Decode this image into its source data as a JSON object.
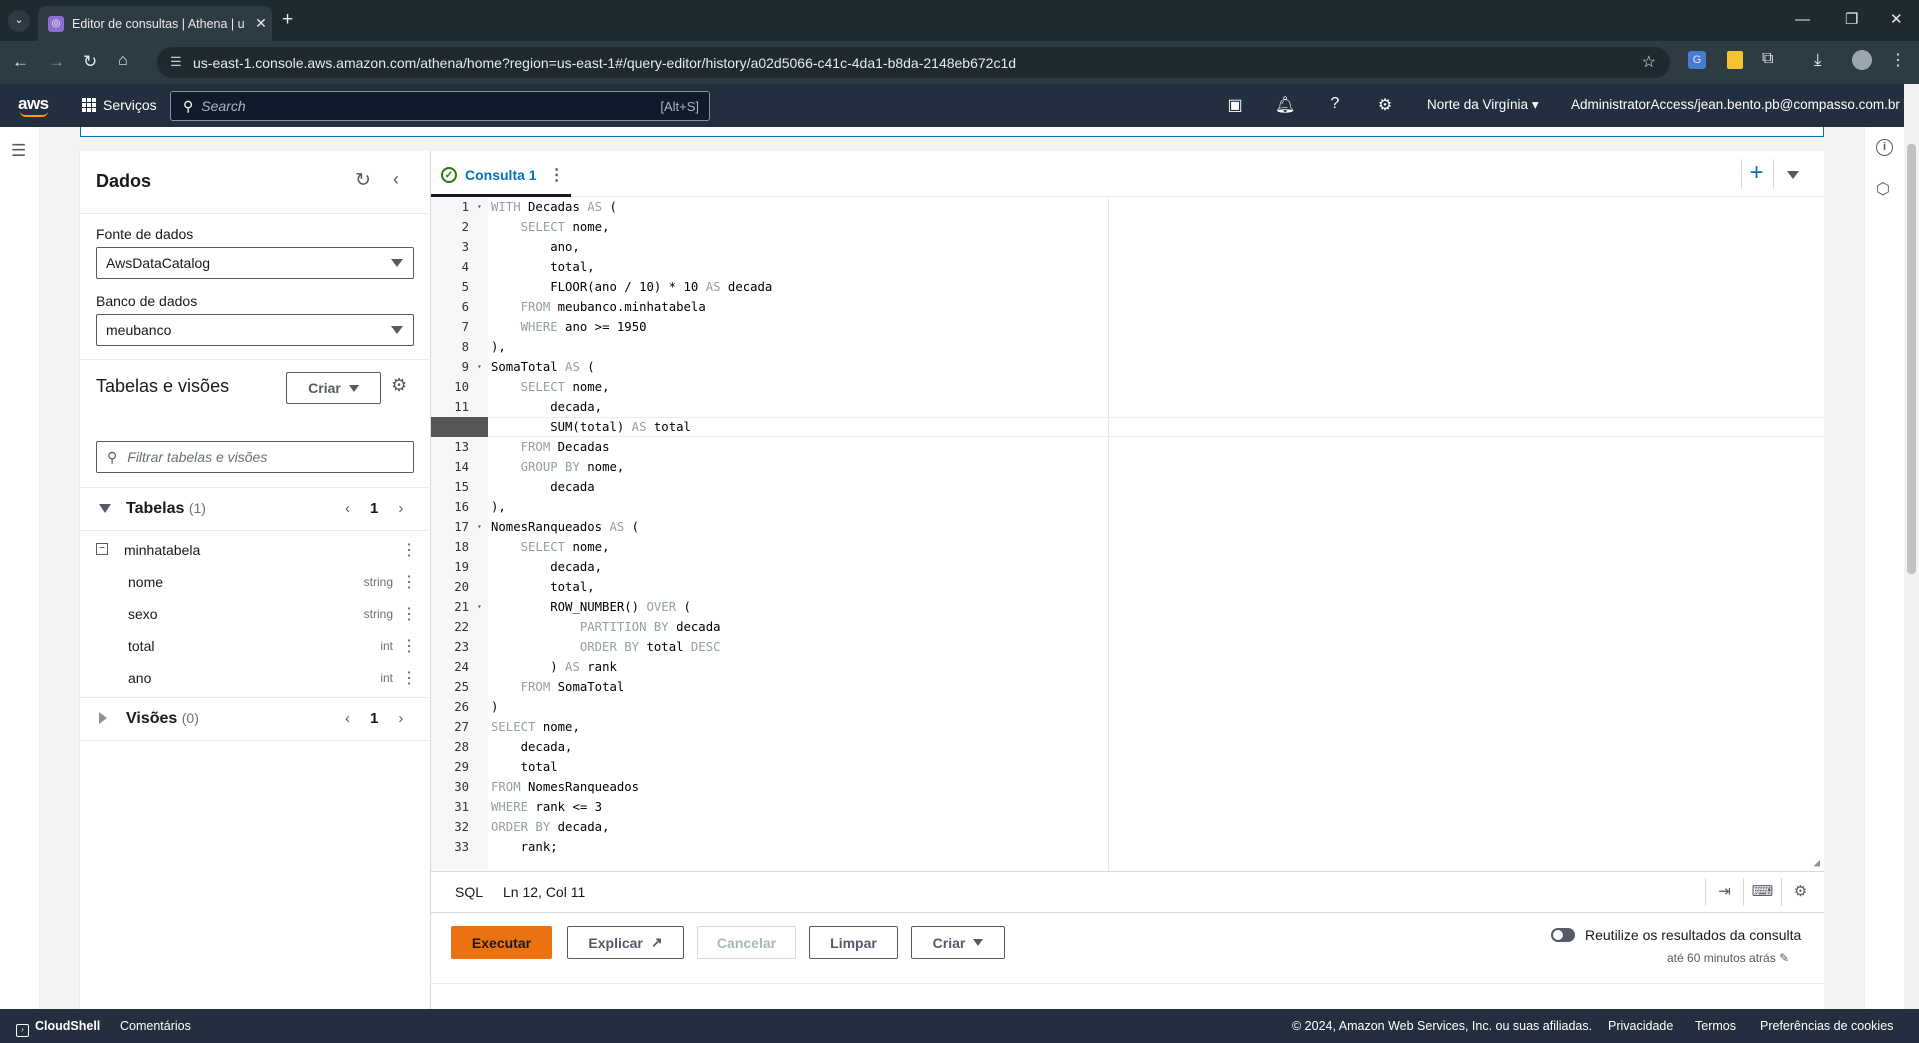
{
  "browser": {
    "tab_title": "Editor de consultas | Athena | u",
    "url": "us-east-1.console.aws.amazon.com/athena/home?region=us-east-1#/query-editor/history/a02d5066-c41c-4da1-b8da-2148eb672c1d"
  },
  "aws_nav": {
    "logo": "aws",
    "services_label": "Serviços",
    "search_placeholder": "Search",
    "search_shortcut": "[Alt+S]",
    "region": "Norte da Virgínia",
    "account": "AdministratorAccess/jean.bento.pb@compasso.com.br"
  },
  "data_panel": {
    "title": "Dados",
    "source_label": "Fonte de dados",
    "source_value": "AwsDataCatalog",
    "db_label": "Banco de dados",
    "db_value": "meubanco",
    "tables_views_title": "Tabelas e visões",
    "create_label": "Criar",
    "filter_placeholder": "Filtrar tabelas e visões",
    "tables": {
      "label": "Tabelas",
      "count": "(1)",
      "page": "1"
    },
    "table_name": "minhatabela",
    "columns": [
      {
        "name": "nome",
        "type": "string"
      },
      {
        "name": "sexo",
        "type": "string"
      },
      {
        "name": "total",
        "type": "int"
      },
      {
        "name": "ano",
        "type": "int"
      }
    ],
    "views": {
      "label": "Visões",
      "count": "(0)",
      "page": "1"
    }
  },
  "editor": {
    "tab_label": "Consulta 1",
    "code_lines": [
      "WITH Decadas AS (",
      "    SELECT nome,",
      "        ano,",
      "        total,",
      "        FLOOR(ano / 10) * 10 AS decada",
      "    FROM meubanco.minhatabela",
      "    WHERE ano >= 1950",
      "),",
      "SomaTotal AS (",
      "    SELECT nome,",
      "        decada,",
      "        SUM(total) AS total",
      "    FROM Decadas",
      "    GROUP BY nome,",
      "        decada",
      "),",
      "NomesRanqueados AS (",
      "    SELECT nome,",
      "        decada,",
      "        total,",
      "        ROW_NUMBER() OVER (",
      "            PARTITION BY decada",
      "            ORDER BY total DESC",
      "        ) AS rank",
      "    FROM SomaTotal",
      ")",
      "SELECT nome,",
      "    decada,",
      "    total",
      "FROM NomesRanqueados",
      "WHERE rank <= 3",
      "ORDER BY decada,",
      "    rank;"
    ],
    "fold_lines": [
      1,
      9,
      17,
      21
    ],
    "active_line": 12,
    "status_lang": "SQL",
    "status_pos": "Ln 12, Col 11",
    "run_label": "Executar",
    "explain_label": "Explicar",
    "cancel_label": "Cancelar",
    "clear_label": "Limpar",
    "create_label": "Criar",
    "reuse_label": "Reutilize os resultados da consulta",
    "reuse_sub": "até 60 minutos atrás"
  },
  "footer": {
    "cloudshell": "CloudShell",
    "comments": "Comentários",
    "copyright": "© 2024, Amazon Web Services, Inc. ou suas afiliadas.",
    "privacy": "Privacidade",
    "terms": "Termos",
    "cookies": "Preferências de cookies"
  }
}
